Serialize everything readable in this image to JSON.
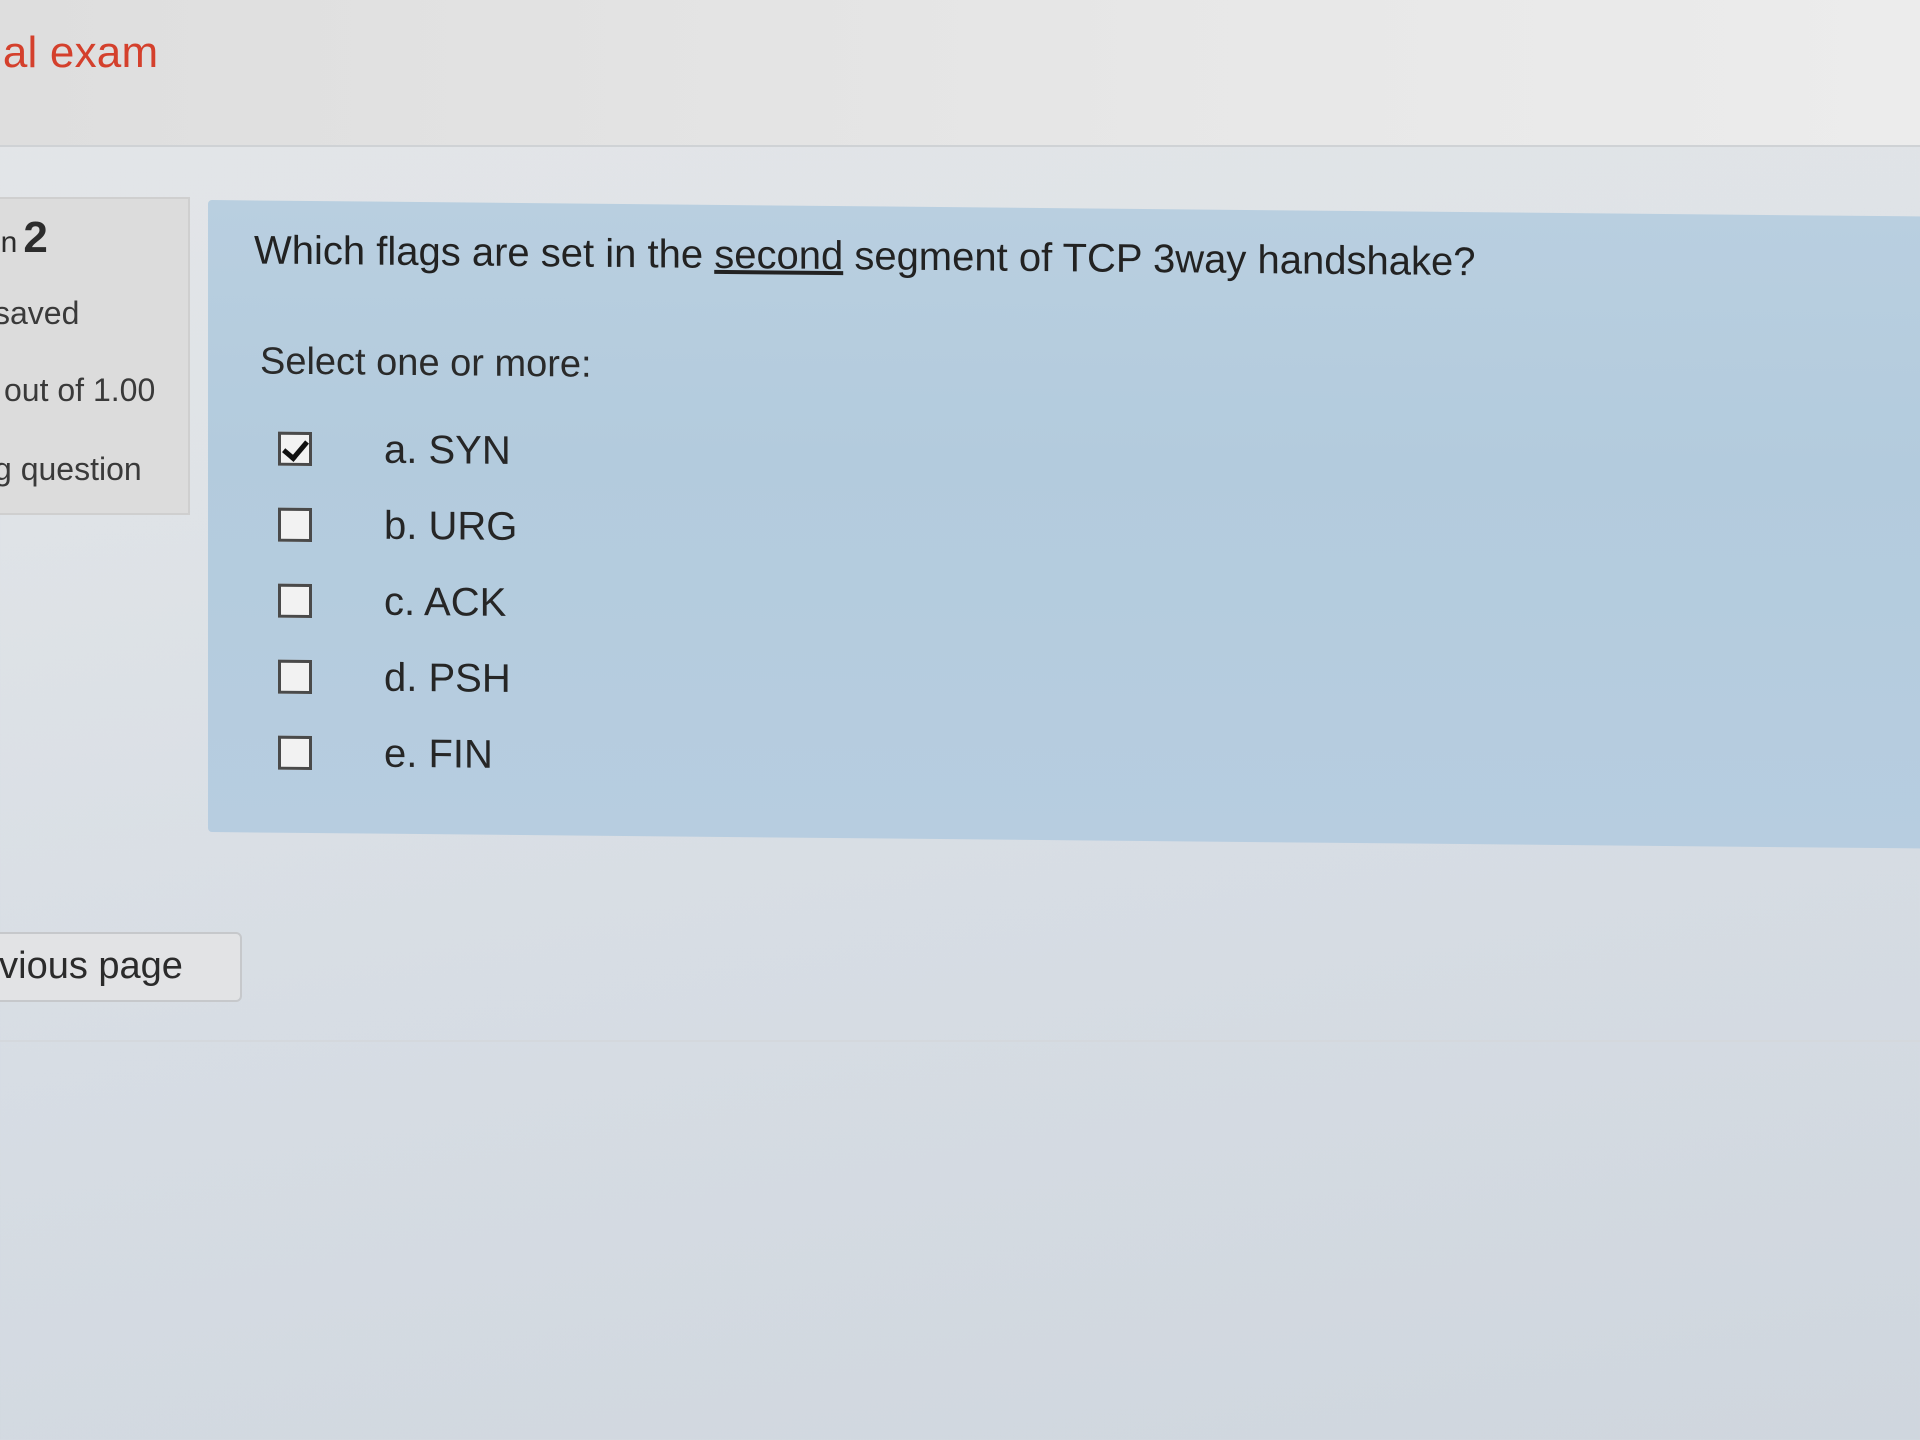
{
  "header": {
    "title": "rial exam"
  },
  "info": {
    "question_label": "on",
    "question_number": "2",
    "status": "saved",
    "grade": "out of 1.00",
    "flag": "g question"
  },
  "question": {
    "text_before": "Which flags are set in the ",
    "text_underlined": "second",
    "text_after": " segment of TCP 3way handshake?",
    "prompt": "Select one or more:",
    "answers": [
      {
        "label": "a. SYN",
        "checked": true
      },
      {
        "label": "b. URG",
        "checked": false
      },
      {
        "label": "c. ACK",
        "checked": false
      },
      {
        "label": "d. PSH",
        "checked": false
      },
      {
        "label": "e. FIN",
        "checked": false
      }
    ]
  },
  "navigation": {
    "previous_label": "evious page"
  }
}
